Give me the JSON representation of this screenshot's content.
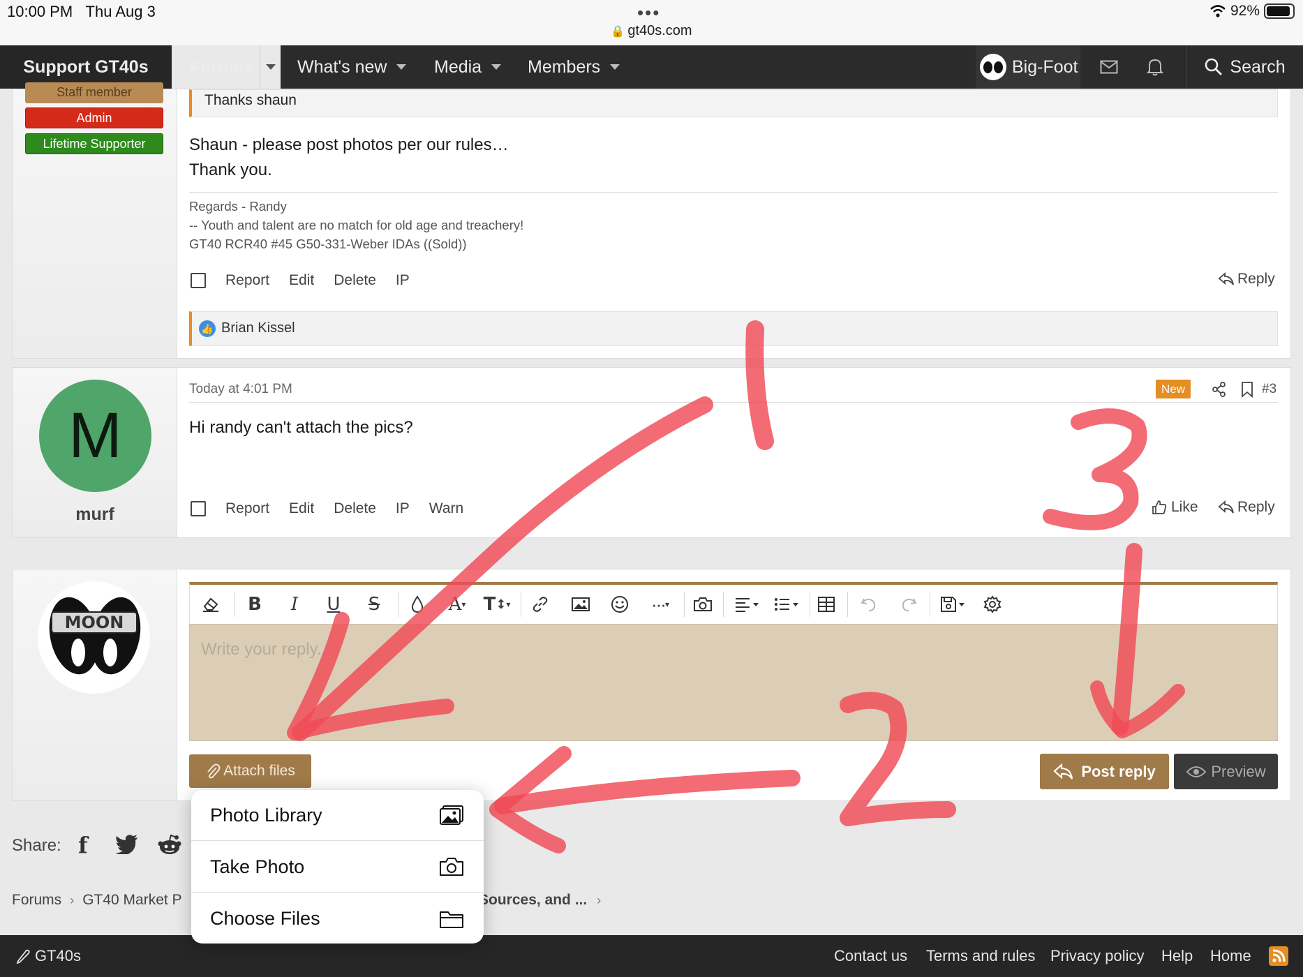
{
  "status_bar": {
    "time": "10:00 PM",
    "date": "Thu Aug 3",
    "url": "gt40s.com",
    "battery": "92%",
    "battery_level": 0.92
  },
  "nav": {
    "support": "Support GT40s",
    "forums": "Forums",
    "whats_new": "What's new",
    "media": "Media",
    "members": "Members",
    "user": "Big-Foot",
    "search": "Search"
  },
  "post2": {
    "badges": [
      "Staff member",
      "Admin",
      "Lifetime Supporter"
    ],
    "quote": "Thanks shaun",
    "body_line1": "Shaun - please post photos per our rules…",
    "body_line2": "Thank you.",
    "signature": [
      "Regards - Randy",
      "-- Youth and talent are no match for old age and treachery!",
      "GT40 RCR40 #45 G50-331-Weber IDAs ((Sold))"
    ],
    "actions": [
      "Report",
      "Edit",
      "Delete",
      "IP"
    ],
    "reply": "Reply",
    "likes": "Brian Kissel"
  },
  "post3": {
    "avatar_letter": "M",
    "username": "murf",
    "timestamp": "Today at 4:01 PM",
    "new_badge": "New",
    "number": "#3",
    "body": "Hi randy can't attach the pics?",
    "actions": [
      "Report",
      "Edit",
      "Delete",
      "IP",
      "Warn"
    ],
    "like": "Like",
    "reply": "Reply"
  },
  "editor": {
    "avatar_text": "MOON",
    "placeholder": "Write your reply...",
    "attach": "Attach files",
    "post_reply": "Post reply",
    "preview": "Preview"
  },
  "attach_menu": {
    "items": [
      "Photo Library",
      "Take Photo",
      "Choose Files"
    ]
  },
  "share": {
    "label": "Share:"
  },
  "breadcrumb": {
    "items": [
      "Forums",
      "GT40 Market P",
      "Sources, and ..."
    ]
  },
  "annotations": [
    "1",
    "2",
    "3"
  ],
  "footer": {
    "brand": "GT40s",
    "links": [
      "Contact us",
      "Terms and rules",
      "Privacy policy",
      "Help",
      "Home"
    ]
  },
  "colors": {
    "brand_red": "#f0412a",
    "admin_red": "#d42a1a",
    "supporter_green": "#2f8a1e",
    "staff_tan": "#b88b55",
    "accent_orange": "#e58e24",
    "editor_bg": "#dccdb6",
    "post_reply_btn": "#a07a49",
    "annotation_red": "#f04a55",
    "avatar_green": "#4fa56a"
  }
}
